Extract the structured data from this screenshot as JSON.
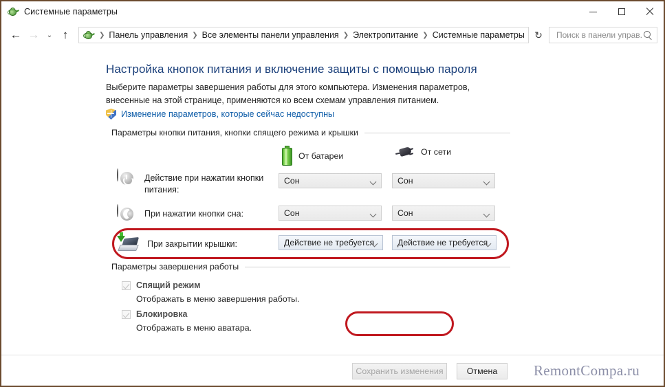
{
  "window": {
    "title": "Системные параметры",
    "icon": "control-panel-icon",
    "controls": {
      "minimize": "–",
      "maximize": "□",
      "close": "✕"
    }
  },
  "addressbar": {
    "back_icon": "back-arrow-icon",
    "forward_icon": "forward-arrow-icon",
    "recent_icon": "chevron-down-icon",
    "up_icon": "up-arrow-icon",
    "refresh_icon": "refresh-icon",
    "separator": "❯",
    "breadcrumb": [
      "Панель управления",
      "Все элементы панели управления",
      "Электропитание",
      "Системные параметры"
    ],
    "search": {
      "placeholder": "Поиск в панели управ...",
      "value": "",
      "icon": "search-icon"
    }
  },
  "page": {
    "title": "Настройка кнопок питания и включение защиты с помощью пароля",
    "description": "Выберите параметры завершения работы для этого компьютера. Изменения параметров, внесенные на этой странице, применяются ко всем схемам управления питанием.",
    "uac_link": "Изменение параметров, которые сейчас недоступны",
    "uac_icon": "shield-icon"
  },
  "groups": {
    "buttons_and_lid": {
      "header": "Параметры кнопки питания, кнопки спящего режима и крышки",
      "columns": [
        {
          "label": "От батареи",
          "icon": "battery-icon"
        },
        {
          "label": "От сети",
          "icon": "power-plug-icon"
        }
      ],
      "rows": [
        {
          "id": "power-button",
          "icon": "power-button-icon",
          "label": "Действие при нажатии кнопки питания:",
          "battery_value": "Сон",
          "mains_value": "Сон",
          "highlighted": false
        },
        {
          "id": "sleep-button",
          "icon": "sleep-button-icon",
          "label": "При нажатии кнопки сна:",
          "battery_value": "Сон",
          "mains_value": "Сон",
          "highlighted": false
        },
        {
          "id": "lid-close",
          "icon": "laptop-lid-icon",
          "label": "При закрытии крышки:",
          "battery_value": "Действие не требуется",
          "mains_value": "Действие не требуется",
          "highlighted": true
        }
      ]
    },
    "shutdown": {
      "header": "Параметры завершения работы",
      "options": [
        {
          "id": "hibernate",
          "label": "Спящий режим",
          "description": "Отображать в меню завершения работы.",
          "checked": true,
          "disabled": true
        },
        {
          "id": "lock",
          "label": "Блокировка",
          "description": "Отображать в меню аватара.",
          "checked": true,
          "disabled": true
        }
      ]
    }
  },
  "footer": {
    "save_label": "Сохранить изменения",
    "save_disabled": true,
    "save_highlighted": true,
    "cancel_label": "Отмена",
    "watermark": "RemontCompa.ru"
  },
  "colors": {
    "highlight_red": "#c0181f",
    "link_blue": "#0d5ca8",
    "title_blue": "#1a3f7a",
    "battery_green": "#4fa832",
    "watermark": "#8c8fa8"
  }
}
